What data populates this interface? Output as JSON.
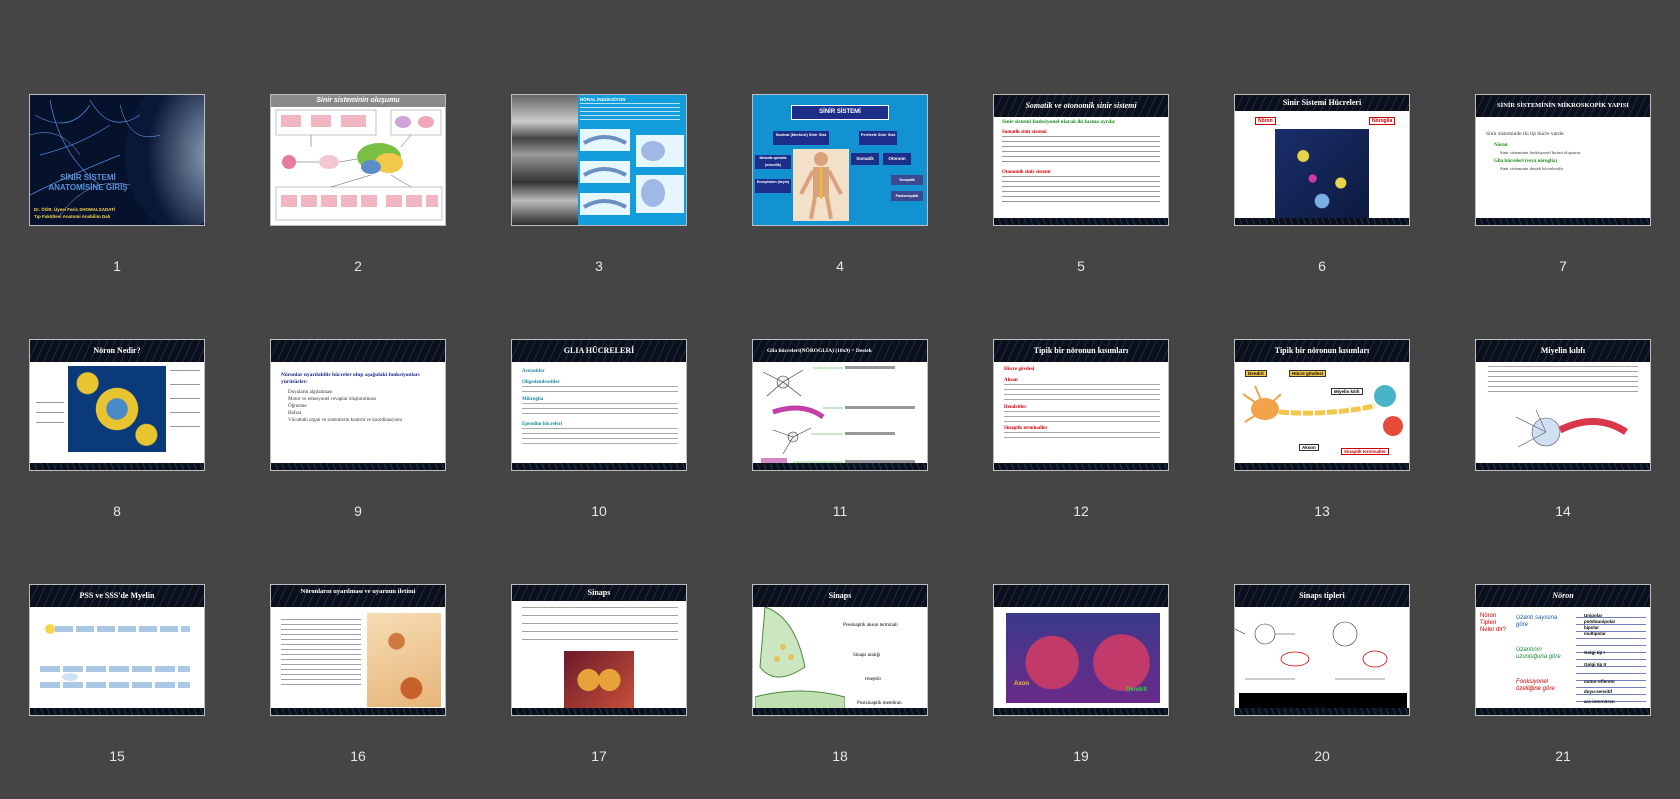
{
  "slides": [
    {
      "number": "1",
      "title": "SİNİR SİSTEMİ ANATOMİSİNE GİRİŞ",
      "author": "Dr. ÖĞR. Üyesi Faris SHOMALSADATİ",
      "dept": "Tıp Fakültesi Anatomi Anabilim Dalı"
    },
    {
      "number": "2",
      "title": "Sinir sisteminin oluşumu"
    },
    {
      "number": "3",
      "title": "NÖRAL İNDÜKSİYON"
    },
    {
      "number": "4",
      "title": "SİNİR SİSTEMİ",
      "central": "Santral (Merkezi) Sinir Sist",
      "peripheral": "Periferik Sinir Sist",
      "spinal": "Medulla spinalis (omurilik)",
      "brain": "Encephalon (beyin)",
      "somatic": "Somatik",
      "autonomic": "Otonom",
      "symp": "Sempatik",
      "parasymp": "Parasempatik"
    },
    {
      "number": "5",
      "title": "Somatik ve otonomik sinir sistemi",
      "subtitle": "Sinir sistemi fonksiyonel olarak iki kısma ayrılır",
      "h1": "Somatik sinir sistemi",
      "h2": "Otonomik sinir sistemi"
    },
    {
      "number": "6",
      "title": "Sinir Sistemi Hücreleri",
      "left": "Nöron",
      "right": "Nöroglia"
    },
    {
      "number": "7",
      "title": "SİNİR SİSTEMİNİN MİKROSKOPİK YAPISI",
      "line1": "Sinir sisteminde iki tip hücre vardır",
      "line2": "Nöron",
      "line3": "Sinir sisteminin fonksiyonel birimi oluşturur",
      "line4": "Glia hücreleri (veya nöroglia)",
      "line5": "Sinir sisteminin destek hücreleridir"
    },
    {
      "number": "8",
      "title": "Nöron Nedir?"
    },
    {
      "number": "9",
      "title": "",
      "line1": "Nöronlar uyarılabilir hücreler olup aşağıdaki fonksiyonları yürütürler:",
      "items": [
        "Duyuların algılanması",
        "Motor ve emosyonel cevaplar oluşturulması",
        "Öğrenme",
        "Hafıza",
        "Vücuttaki organ ve sistemlerin kontrol ve koordinasyonu"
      ]
    },
    {
      "number": "10",
      "title": "GLIA HÜCRELERİ",
      "items": [
        "Astrositler",
        "Oligodendrositler",
        "Mikroglia",
        "Ependim hücreleri"
      ]
    },
    {
      "number": "11",
      "title": "Glia hücreleri(NÖROGLIA) (10x9) = Destek"
    },
    {
      "number": "12",
      "title": "Tipik bir nöronun kısımları",
      "items": [
        "Hücre gövdesi",
        "Akson",
        "Dendritler",
        "Sinaptik terminaller"
      ]
    },
    {
      "number": "13",
      "title": "Tipik bir nöronun kısımları",
      "labels": [
        "Dendrit",
        "Hücre gövdesi",
        "Miyelin kılıfı",
        "Akson",
        "Sinaptik terminaller"
      ]
    },
    {
      "number": "14",
      "title": "Miyelin kılıfı"
    },
    {
      "number": "15",
      "title": "PSS ve SSS'de Myelin"
    },
    {
      "number": "16",
      "title": "Nöronların uyarılması ve uyarının iletimi"
    },
    {
      "number": "17",
      "title": "Sinaps"
    },
    {
      "number": "18",
      "title": "Sinaps",
      "labels": [
        "Presinaptik akson terminali",
        "Sinaps aralığı",
        "reseptör",
        "Postsinaptik membran"
      ]
    },
    {
      "number": "19",
      "title": "",
      "axon": "Axon",
      "dendrite": "Dendrit"
    },
    {
      "number": "20",
      "title": "Sinaps tipleri"
    },
    {
      "number": "21",
      "title": "Nöron",
      "side": "Nöron Tipleri Neler dir?",
      "g1": "Uzantı sayısına göre",
      "g2": "Uzantının uzunluğuna göre",
      "g3": "Fonksiyonel özelliğine göre",
      "r1": [
        "Unipolar",
        "psödounipolar",
        "bipolar",
        "multipolar"
      ],
      "r2": [
        "Golgi tip I",
        "Golgi tip II"
      ],
      "r3": [
        "motor-efferent",
        "duyu-sensitif",
        "ara-internöron"
      ]
    }
  ],
  "colors": {
    "background": "#454545",
    "label": "#e6e6e6",
    "border": "#bdbdbd"
  }
}
